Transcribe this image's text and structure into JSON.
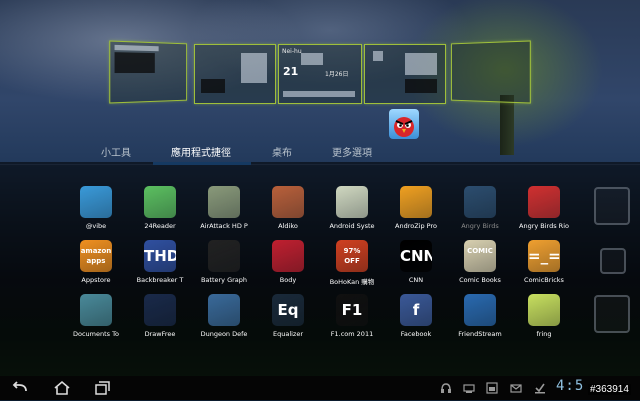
{
  "home_panes": {
    "pane3_location": "Nei-hu",
    "pane3_time": "21",
    "pane3_date": "1月26日"
  },
  "tabs": [
    {
      "label": "小工具",
      "active": false
    },
    {
      "label": "應用程式捷徑",
      "active": true
    },
    {
      "label": "桌布",
      "active": false
    },
    {
      "label": "更多選項",
      "active": false
    }
  ],
  "apps": [
    {
      "label": "@vibe",
      "icon": "vibe-tent-icon",
      "color": "#3a9ad9"
    },
    {
      "label": "24Reader",
      "icon": "reader-figure-icon",
      "color": "#5cc060"
    },
    {
      "label": "AirAttack HD P",
      "icon": "airattack-icon",
      "color": "#8a9a7a"
    },
    {
      "label": "Aldiko",
      "icon": "bookshelf-icon",
      "color": "#b9603a"
    },
    {
      "label": "Android Syste",
      "icon": "android-system-icon",
      "color": "#d0d8c0"
    },
    {
      "label": "AndroZip Pro",
      "icon": "zip-box-icon",
      "color": "#f0a020"
    },
    {
      "label": "Angry Birds",
      "icon": "angry-bird-icon",
      "color": "#5aa0e0",
      "faded": true
    },
    {
      "label": "Angry Birds Rio",
      "icon": "angry-bird-rio-icon",
      "color": "#d03030"
    },
    {
      "label": "Appstore",
      "icon": "amazon-appstore-icon",
      "color": "#f09020",
      "text": "amazon apps"
    },
    {
      "label": "Backbreaker T",
      "icon": "backbreaker-icon",
      "color": "#3050a0",
      "text": "THD"
    },
    {
      "label": "Battery Graph",
      "icon": "battery-graph-icon",
      "color": "#222222"
    },
    {
      "label": "Body",
      "icon": "heart-icon",
      "color": "#c02030"
    },
    {
      "label": "BoHoKan 購物",
      "icon": "bohokan-icon",
      "color": "#d04020",
      "text": "97% OFF"
    },
    {
      "label": "CNN",
      "icon": "cnn-icon",
      "color": "#000000",
      "text": "CNN"
    },
    {
      "label": "Comic Books",
      "icon": "comic-books-icon",
      "color": "#d8d0b0",
      "text": "COMIC"
    },
    {
      "label": "ComicBricks",
      "icon": "comicbricks-icon",
      "color": "#f0a030",
      "text": "=_="
    },
    {
      "label": "Documents To",
      "icon": "documents-to-go-icon",
      "color": "#4a8a9a"
    },
    {
      "label": "DrawFree",
      "icon": "pen-nib-icon",
      "color": "#1a2a4a"
    },
    {
      "label": "Dungeon Defe",
      "icon": "dungeon-defenders-icon",
      "color": "#3a6a9a"
    },
    {
      "label": "Equalizer",
      "icon": "equalizer-icon",
      "color": "#1a2a3a",
      "text": "Eq"
    },
    {
      "label": "F1.com 2011",
      "icon": "f1-icon",
      "color": "#101010",
      "text": "F1"
    },
    {
      "label": "Facebook",
      "icon": "facebook-icon",
      "color": "#3b5998",
      "text": "f"
    },
    {
      "label": "FriendStream",
      "icon": "friendstream-icon",
      "color": "#2a6ab0"
    },
    {
      "label": "fring",
      "icon": "fring-icon",
      "color": "#c8e060"
    }
  ],
  "statusbar": {
    "clock": "4:5",
    "watermark": "#363914"
  },
  "colors": {
    "accent": "#2f7fd8",
    "pane_border": "#9fbf3a"
  }
}
